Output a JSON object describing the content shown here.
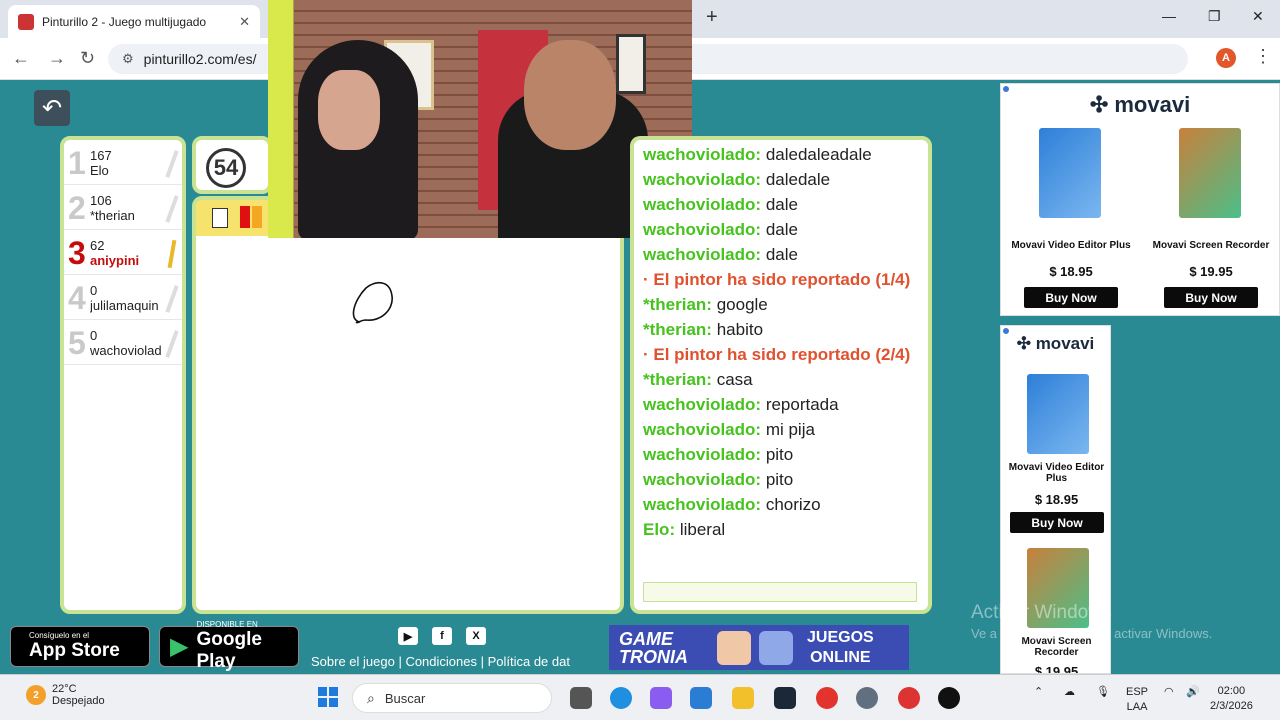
{
  "browser": {
    "tab_title": "Pinturillo 2 - Juego multijugado",
    "url": "pinturillo2.com/es/",
    "profile_initial": "A"
  },
  "game": {
    "timer": "54",
    "players": [
      {
        "rank": "1",
        "score": "167",
        "name": "Elo",
        "active": false
      },
      {
        "rank": "2",
        "score": "106",
        "name": "*therian",
        "active": false
      },
      {
        "rank": "3",
        "score": "62",
        "name": "aniypini",
        "active": true
      },
      {
        "rank": "4",
        "score": "0",
        "name": "julilamaquin",
        "active": false
      },
      {
        "rank": "5",
        "score": "0",
        "name": "wachoviolad",
        "active": false
      }
    ],
    "chat": [
      {
        "user": "wachoviolado:",
        "text": "daledaleadale"
      },
      {
        "user": "wachoviolado:",
        "text": "daledale"
      },
      {
        "user": "wachoviolado:",
        "text": "dale"
      },
      {
        "user": "wachoviolado:",
        "text": "dale"
      },
      {
        "user": "wachoviolado:",
        "text": "dale"
      },
      {
        "system": "· El pintor ha sido reportado (1/4)"
      },
      {
        "user": "*therian:",
        "text": "google"
      },
      {
        "user": "*therian:",
        "text": "habito"
      },
      {
        "system": "· El pintor ha sido reportado (2/4)"
      },
      {
        "user": "*therian:",
        "text": "casa"
      },
      {
        "user": "wachoviolado:",
        "text": "reportada"
      },
      {
        "user": "wachoviolado:",
        "text": "mi pija"
      },
      {
        "user": "wachoviolado:",
        "text": "pito"
      },
      {
        "user": "wachoviolado:",
        "text": "pito"
      },
      {
        "user": "wachoviolado:",
        "text": "chorizo"
      },
      {
        "user": "Elo:",
        "text": "liberal"
      }
    ]
  },
  "ads": {
    "brand": "movavi",
    "ad1": {
      "p1": "Movavi Video Editor Plus",
      "p1_price": "$ 18.95",
      "p2": "Movavi Screen Recorder",
      "p2_price": "$ 19.95",
      "buy": "Buy Now"
    },
    "ad2": {
      "p1": "Movavi Video Editor Plus",
      "p1_price": "$ 18.95",
      "p2": "Movavi Screen Recorder",
      "p2_price": "$ 19.95",
      "buy": "Buy Now"
    }
  },
  "footer": {
    "appstore_small": "Consíguelo en el",
    "appstore_big": "App Store",
    "googleplay_small": "DISPONIBLE EN",
    "googleplay_big": "Google Play",
    "links": "Sobre el juego | Condiciones | Política de dat",
    "gametronia_line1": "GAME",
    "gametronia_line2": "TRONIA",
    "juegos": "JUEGOS",
    "online": "ONLINE"
  },
  "windows_activation": {
    "line1": "Activar Windows",
    "line2": "Ve a Configuración para activar Windows."
  },
  "taskbar": {
    "temperature": "22°C",
    "weather": "Despejado",
    "weather_badge": "2",
    "search": "Buscar",
    "lang1": "ESP",
    "lang2": "LAA",
    "time": "02:00",
    "date": "2/3/2026"
  }
}
